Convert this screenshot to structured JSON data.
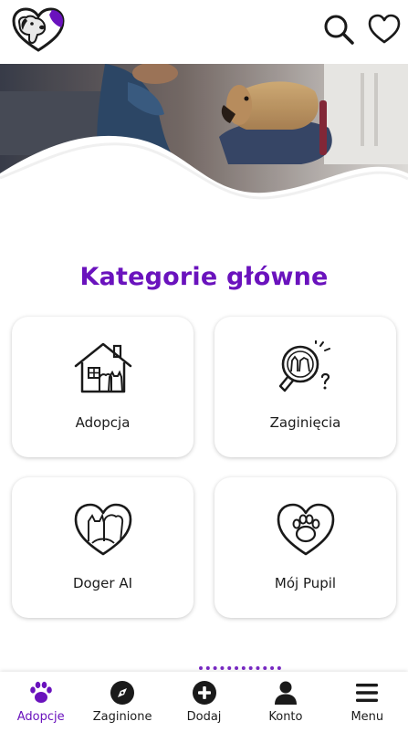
{
  "colors": {
    "accent": "#6a12bd",
    "text": "#1c1c1c",
    "background": "#ffffff"
  },
  "header": {
    "logo_icon": "dog-heart-logo-icon",
    "search_icon": "search-icon",
    "favorites_icon": "heart-icon"
  },
  "hero": {
    "image": "child-with-dog-photo"
  },
  "main": {
    "title": "Kategorie główne",
    "categories": [
      {
        "label": "Adopcja",
        "icon": "house-pets-icon"
      },
      {
        "label": "Zaginięcia",
        "icon": "magnifier-pets-icon"
      },
      {
        "label": "Doger AI",
        "icon": "heart-pets-icon"
      },
      {
        "label": "Mój Pupil",
        "icon": "heart-paw-icon"
      }
    ]
  },
  "bottom_nav": {
    "active": "Adopcje",
    "items": [
      {
        "label": "Adopcje",
        "icon": "paw-icon"
      },
      {
        "label": "Zaginione",
        "icon": "compass-icon"
      },
      {
        "label": "Dodaj",
        "icon": "plus-circle-icon"
      },
      {
        "label": "Konto",
        "icon": "user-icon"
      },
      {
        "label": "Menu",
        "icon": "menu-icon"
      }
    ]
  }
}
